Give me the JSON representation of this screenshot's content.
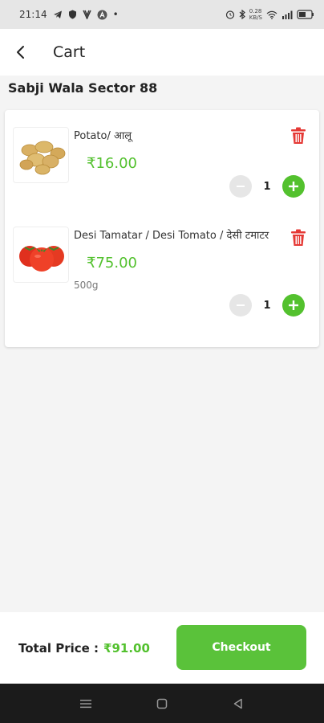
{
  "status_bar": {
    "time": "21:14",
    "dot": "•",
    "speed_top": "0.28",
    "speed_bottom": "KB/S",
    "icons": [
      "telegram-icon",
      "shield-icon",
      "vpn-icon",
      "app-a-icon",
      "alarm-icon",
      "bluetooth-icon",
      "wifi-icon",
      "signal-icon",
      "battery-icon"
    ]
  },
  "header": {
    "title": "Cart"
  },
  "store": {
    "name": "Sabji Wala Sector 88"
  },
  "cart": {
    "items": [
      {
        "name": "Potato/ आलू",
        "price": "₹16.00",
        "unit": "",
        "quantity": "1",
        "image": "potato-image"
      },
      {
        "name": "Desi Tamatar / Desi Tomato / देसी टमाटर",
        "price": "₹75.00",
        "unit": "500g",
        "quantity": "1",
        "image": "tomato-image"
      }
    ]
  },
  "footer": {
    "total_label": "Total Price :",
    "total_value": "₹91.00",
    "checkout_label": "Checkout"
  },
  "colors": {
    "accent": "#53c12e",
    "button": "#5ac23a",
    "delete": "#e53935"
  }
}
